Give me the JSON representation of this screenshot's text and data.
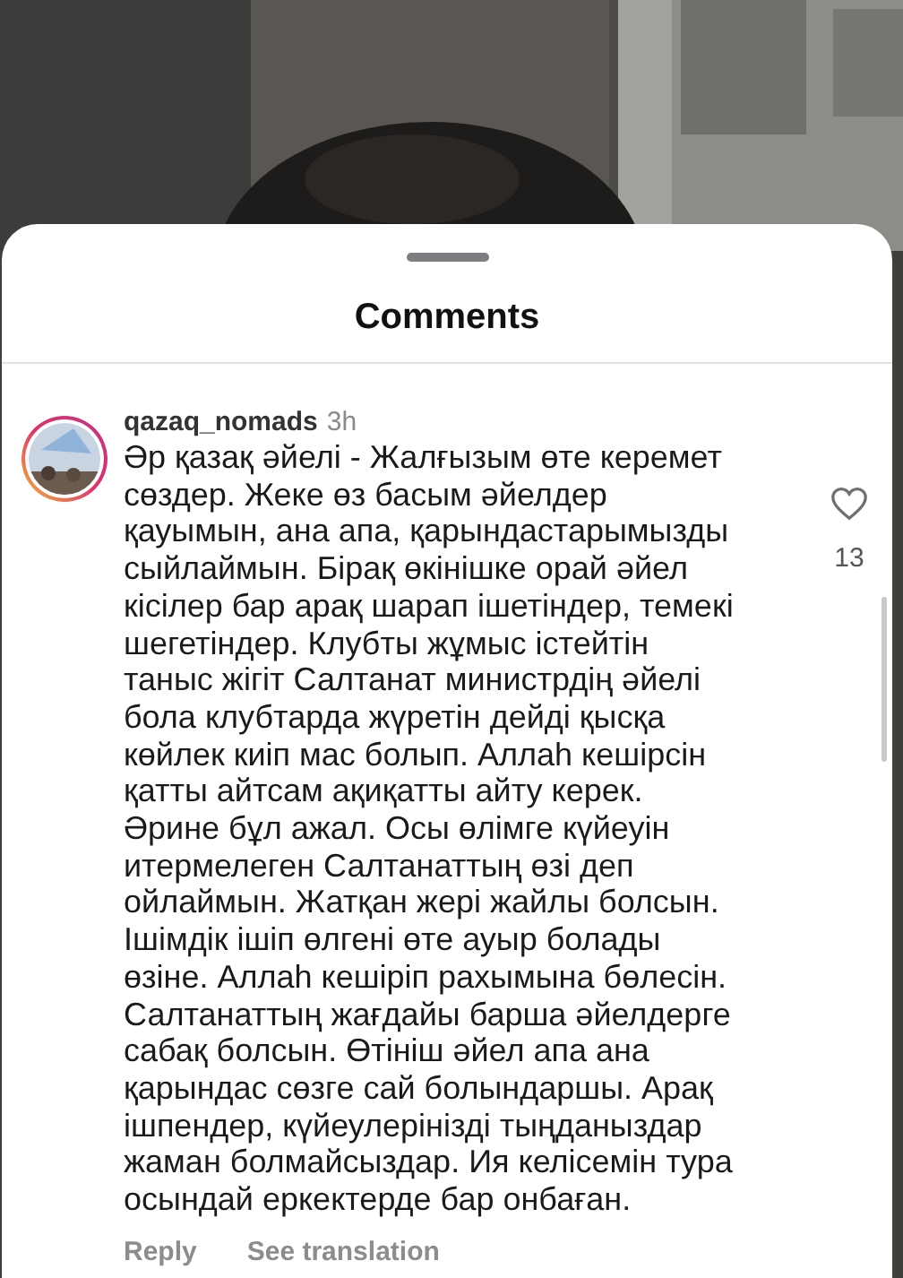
{
  "sheet": {
    "title": "Comments"
  },
  "comments": [
    {
      "username": "qazaq_nomads",
      "time": "3h",
      "liked": false,
      "like_count": "13",
      "text": "Әр қазақ әйелі - Жалғызым өте керемет\nсөздер. Жеке өз басым әйелдер\nқауымын, ана апа, қарындастарымызды\nсыйлаймын. Бірақ өкінішке орай әйел\nкісілер бар арақ шарап ішетіндер, темекі\nшегетіндер. Клубты жұмыс істейтін\nтаныс жігіт Салтанат министрдің әйелі\nбола клубтарда жүретін дейді қысқа\nкөйлек киіп мас болып. Аллаһ кешірсін\nқатты айтсам ақиқатты айту керек.\nӘрине бұл ажал. Осы өлімге күйеуін\nитермелеген Салтанаттың өзі  деп\nойлаймын. Жатқан жері жайлы болсын.\nІшімдік ішіп өлгені өте ауыр болады\nөзіне. Аллаһ кешіріп рахымына бөлесін.\nСалтанаттың жағдайы барша әйелдерге\nсабақ болсын. Өтініш әйел апа ана\nқарындас сөзге сай болындаршы. Арақ\nішпендер, күйеулерінізді тыңданыздар\nжаман болмайсыздар. Ия келісемін тура\nосындай еркектерде бар онбаған.",
      "actions": [
        "Reply",
        "See translation"
      ]
    }
  ]
}
